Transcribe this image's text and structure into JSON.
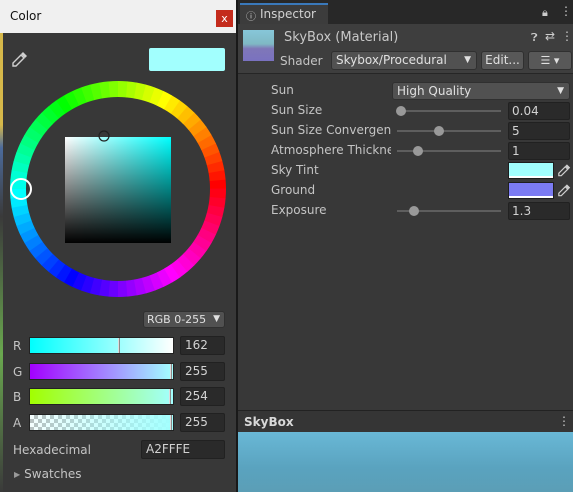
{
  "color_window": {
    "title": "Color",
    "close_glyph": "x",
    "selected_color": "#A2FFFE",
    "mode_dropdown": "RGB 0-255",
    "channels": [
      {
        "label": "R",
        "value": "162",
        "fraction": 0.635,
        "gradient": "linear-gradient(90deg,#00FFFE,#FFFFFE)"
      },
      {
        "label": "G",
        "value": "255",
        "fraction": 1.0,
        "gradient": "linear-gradient(90deg,#A200FE,#A2FFFE)"
      },
      {
        "label": "B",
        "value": "254",
        "fraction": 0.996,
        "gradient": "linear-gradient(90deg,#A2FF00,#A2FFFF)"
      },
      {
        "label": "A",
        "value": "255",
        "fraction": 1.0,
        "gradient": "linear-gradient(90deg,rgba(162,255,254,0.1),#A2FFFE)"
      }
    ],
    "hex_label": "Hexadecimal",
    "hex_value": "A2FFFE",
    "swatches_label": "Swatches"
  },
  "inspector": {
    "tab_label": "Inspector",
    "material_name": "SkyBox (Material)",
    "shader_label": "Shader",
    "shader_value": "Skybox/Procedural",
    "edit_label": "Edit...",
    "list_glyph": "☰ ▾",
    "properties": {
      "sun": {
        "label": "Sun",
        "value": "High Quality"
      },
      "sun_size": {
        "label": "Sun Size",
        "value": "0.04",
        "fraction": 0.04
      },
      "sun_convergence": {
        "label": "Sun Size Convergence",
        "value": "5",
        "fraction": 0.4
      },
      "atmosphere": {
        "label": "Atmosphere Thickness",
        "value": "1",
        "fraction": 0.2
      },
      "sky_tint": {
        "label": "Sky Tint",
        "color": "#A2FFFE"
      },
      "ground": {
        "label": "Ground",
        "color": "#7B7BF2"
      },
      "exposure": {
        "label": "Exposure",
        "value": "1.3",
        "fraction": 0.16
      }
    }
  },
  "preview": {
    "title": "SkyBox",
    "more_glyph": "⋮"
  }
}
